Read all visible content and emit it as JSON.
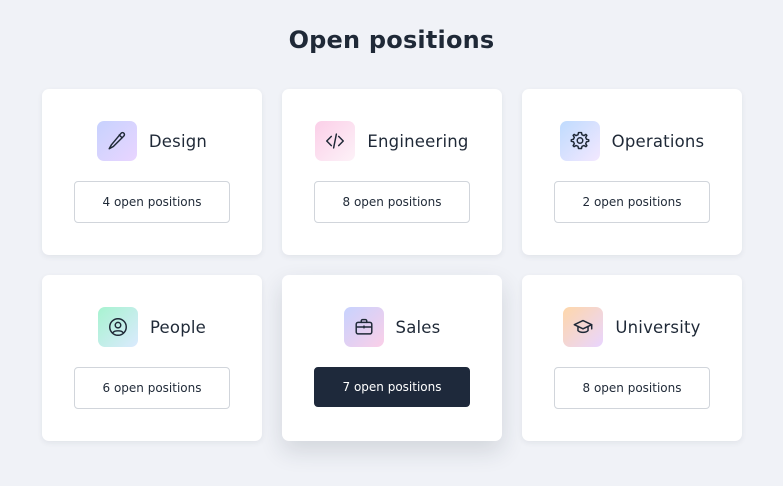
{
  "page": {
    "title": "Open positions"
  },
  "colors": {
    "background": "#f0f2f7",
    "card": "#ffffff",
    "text": "#1f2937",
    "active_button": "#1e293b",
    "button_border": "#d1d5db"
  },
  "departments": [
    {
      "name": "Design",
      "icon": "pencil-icon",
      "positions": "4 open positions",
      "active": false
    },
    {
      "name": "Engineering",
      "icon": "code-icon",
      "positions": "8 open positions",
      "active": false
    },
    {
      "name": "Operations",
      "icon": "gear-icon",
      "positions": "2 open positions",
      "active": false
    },
    {
      "name": "People",
      "icon": "user-circle-icon",
      "positions": "6 open positions",
      "active": false
    },
    {
      "name": "Sales",
      "icon": "briefcase-icon",
      "positions": "7 open positions",
      "active": true
    },
    {
      "name": "University",
      "icon": "graduation-cap-icon",
      "positions": "8 open positions",
      "active": false
    }
  ]
}
